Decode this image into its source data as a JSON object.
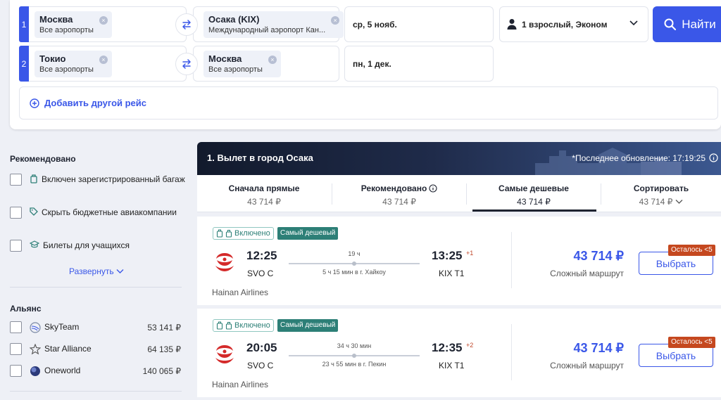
{
  "search": {
    "legs": [
      {
        "num": "1",
        "from_city": "Москва",
        "from_sub": "Все аэропорты",
        "to_city": "Осака (KIX)",
        "to_sub": "Международный аэропорт Кан...",
        "date": "ср, 5 нояб."
      },
      {
        "num": "2",
        "from_city": "Токио",
        "from_sub": "Все аэропорты",
        "to_city": "Москва",
        "to_sub": "Все аэропорты",
        "date": "пн, 1 дек."
      }
    ],
    "passengers": "1 взрослый, Эконом",
    "find_label": "Найти",
    "add_route_label": "Добавить другой рейс"
  },
  "sidebar": {
    "recommended_heading": "Рекомендовано",
    "recommended_items": [
      {
        "label": "Включен зарегистрированный багаж",
        "icon": "baggage-icon"
      },
      {
        "label": "Скрыть бюджетные авиакомпании",
        "icon": "tag-icon"
      },
      {
        "label": "Билеты для учащихся",
        "icon": "student-cap-icon"
      }
    ],
    "expand_label": "Развернуть",
    "alliance_heading": "Альянс",
    "alliances": [
      {
        "name": "SkyTeam",
        "price": "53 141 ₽",
        "icon": "skyteam-icon"
      },
      {
        "name": "Star Alliance",
        "price": "64 135 ₽",
        "icon": "star-alliance-icon"
      },
      {
        "name": "Oneworld",
        "price": "140 065 ₽",
        "icon": "oneworld-icon"
      }
    ]
  },
  "results": {
    "title": "1. Вылет в город Осака",
    "updated": "*Последнее обновление: 17:19:25",
    "sort_tabs": [
      {
        "label": "Сначала прямые",
        "price": "43 714 ₽"
      },
      {
        "label": "Рекомендовано",
        "price": "43 714 ₽"
      },
      {
        "label": "Самые дешевые",
        "price": "43 714 ₽"
      },
      {
        "label": "Сортировать",
        "price": "43 714 ₽"
      }
    ],
    "flights": [
      {
        "bag_label": "Включено",
        "cheap_label": "Самый дешевый",
        "dep_time": "12:25",
        "dep_code": "SVO C",
        "arr_time": "13:25",
        "arr_plus": "+1",
        "arr_code": "KIX T1",
        "duration": "19 ч",
        "stop": "5 ч 15 мин в г. Хайкоу",
        "airline": "Hainan Airlines",
        "price": "43 714 ₽",
        "route_type": "Сложный маршрут",
        "select_label": "Выбрать",
        "seats_left": "Осталось <5"
      },
      {
        "bag_label": "Включено",
        "cheap_label": "Самый дешевый",
        "dep_time": "20:05",
        "dep_code": "SVO C",
        "arr_time": "12:35",
        "arr_plus": "+2",
        "arr_code": "KIX T1",
        "duration": "34 ч 30 мин",
        "stop": "23 ч 55 мин в г. Пекин",
        "airline": "Hainan Airlines",
        "price": "43 714 ₽",
        "route_type": "Сложный маршрут",
        "select_label": "Выбрать",
        "seats_left": "Осталось <5"
      }
    ]
  },
  "colors": {
    "accent": "#3a57e8",
    "badge_green": "#2d7f77",
    "badge_orange": "#c5481f",
    "header_dark": "#121a2c"
  }
}
